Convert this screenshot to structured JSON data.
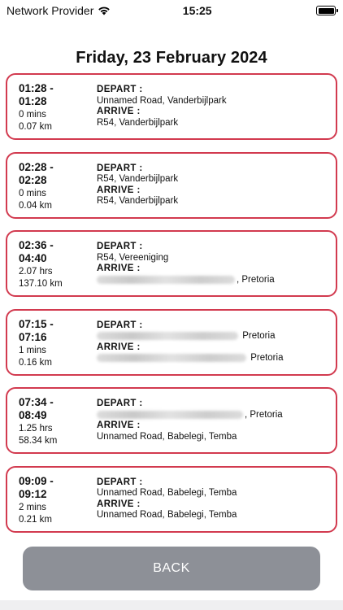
{
  "status_bar": {
    "carrier": "Network Provider",
    "time": "15:25"
  },
  "page_title": "Friday, 23 February 2024",
  "labels": {
    "depart": "DEPART :",
    "arrive": "ARRIVE :"
  },
  "trips": [
    {
      "start": "01:28 -",
      "end": "01:28",
      "duration": "0 mins",
      "distance": "0.07 km",
      "depart": "Unnamed Road, Vanderbijlpark",
      "arrive": "R54, Vanderbijlpark"
    },
    {
      "start": "02:28 -",
      "end": "02:28",
      "duration": "0 mins",
      "distance": "0.04 km",
      "depart": "R54, Vanderbijlpark",
      "arrive": "R54, Vanderbijlpark"
    },
    {
      "start": "02:36 -",
      "end": "04:40",
      "duration": "2.07 hrs",
      "distance": "137.10 km",
      "depart": "R54, Vereeniging",
      "arrive": ", Pretoria"
    },
    {
      "start": "07:15 -",
      "end": "07:16",
      "duration": "1 mins",
      "distance": "0.16 km",
      "depart": " Pretoria",
      "arrive": " Pretoria"
    },
    {
      "start": "07:34 -",
      "end": "08:49",
      "duration": "1.25 hrs",
      "distance": "58.34 km",
      "depart": ", Pretoria",
      "arrive": "Unnamed Road, Babelegi, Temba"
    },
    {
      "start": "09:09 -",
      "end": "09:12",
      "duration": "2 mins",
      "distance": "0.21 km",
      "depart": "Unnamed Road, Babelegi, Temba",
      "arrive": "Unnamed Road, Babelegi, Temba"
    }
  ],
  "back_button": "BACK",
  "icons": [
    "wifi-icon",
    "battery-icon"
  ],
  "colors": {
    "card_border": "#d23a4f",
    "back_button_bg": "#8d9097"
  }
}
